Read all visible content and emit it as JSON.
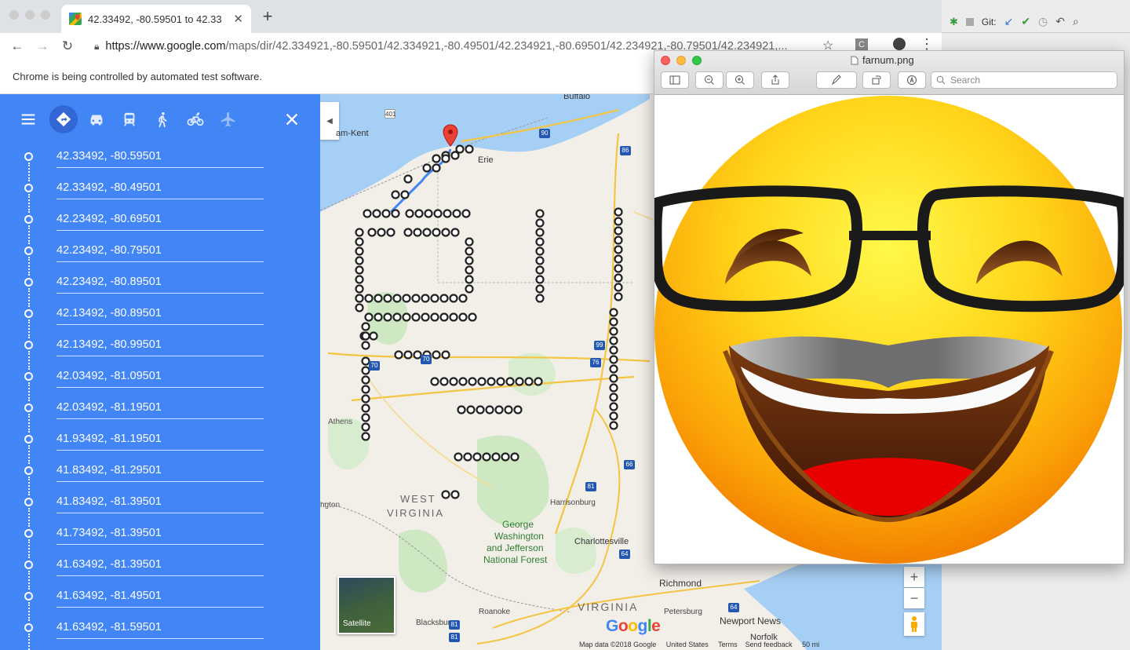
{
  "browser": {
    "tab_title": "42.33492, -80.59501 to 42.33",
    "url_domain": "https://www.google.com",
    "url_path": "/maps/dir/42.334921,-80.59501/42.334921,-80.49501/42.234921,-80.69501/42.234921,-80.79501/42.234921,...",
    "infobar_text": "Chrome is being controlled by automated test software.",
    "ext_label": "C"
  },
  "sidebar": {
    "modes": [
      "directions-icon",
      "car-icon",
      "transit-icon",
      "walk-icon",
      "bike-icon",
      "flight-icon"
    ],
    "waypoints": [
      "42.33492, -80.59501",
      "42.33492, -80.49501",
      "42.23492, -80.69501",
      "42.23492, -80.79501",
      "42.23492, -80.89501",
      "42.13492, -80.89501",
      "42.13492, -80.99501",
      "42.03492, -81.09501",
      "42.03492, -81.19501",
      "41.93492, -81.19501",
      "41.83492, -81.29501",
      "41.83492, -81.39501",
      "41.73492, -81.39501",
      "41.63492, -81.39501",
      "41.63492, -81.49501",
      "41.63492, -81.59501"
    ]
  },
  "map": {
    "labels": {
      "buffalo": "Buffalo",
      "chatham": "am-Kent",
      "erie": "Erie",
      "athens": "Athens",
      "west_virginia": "WEST",
      "west_virginia2": "VIRGINIA",
      "ington": "ngton",
      "harrisonburg": "Harrisonburg",
      "george": "George",
      "washington": "Washington",
      "jefferson": "and Jefferson",
      "forest": "National Forest",
      "charlottesville": "Charlottesville",
      "richmond": "Richmond",
      "virginia": "VIRGINIA",
      "petersburg": "Petersburg",
      "newport_news": "Newport News",
      "roanoke": "Roanoke",
      "blacksburg": "Blacksburg",
      "norfolk": "Norfolk"
    },
    "shields": [
      "401",
      "90",
      "86",
      "99",
      "70",
      "76",
      "70",
      "81",
      "66",
      "81",
      "64",
      "64",
      "81"
    ],
    "satellite_label": "Satellite",
    "logo": "Google",
    "footer": [
      "Map data ©2018 Google",
      "United States",
      "Terms",
      "Send feedback",
      "50 mi"
    ],
    "zoom_in": "+",
    "zoom_out": "−"
  },
  "ide": {
    "git_label": "Git:"
  },
  "preview": {
    "filename": "farnum.png",
    "search_placeholder": "Search"
  },
  "colors": {
    "sidebar_blue": "#4285f4",
    "lake_blue": "#a6cff5",
    "marker_red": "#ea4335"
  }
}
